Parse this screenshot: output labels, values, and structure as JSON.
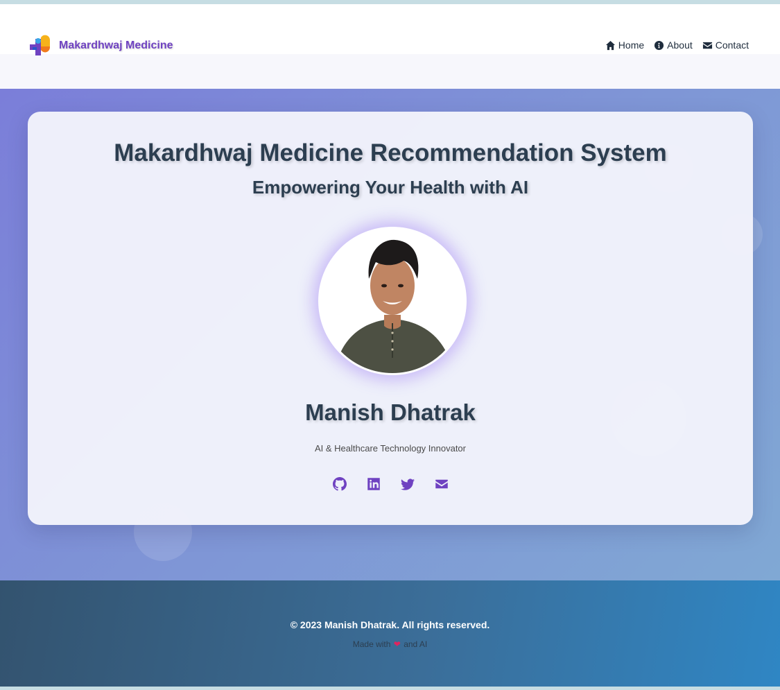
{
  "brand": {
    "name": "Makardhwaj Medicine",
    "logo_icon": "medical-cross-icon"
  },
  "nav": {
    "items": [
      {
        "label": "Home",
        "icon": "home-icon"
      },
      {
        "label": "About",
        "icon": "info-circle-icon"
      },
      {
        "label": "Contact",
        "icon": "envelope-icon"
      }
    ]
  },
  "hero": {
    "title": "Makardhwaj Medicine Recommendation System",
    "subtitle": "Empowering Your Health with AI",
    "profile": {
      "name": "Manish Dhatrak",
      "role": "AI & Healthcare Technology Innovator"
    },
    "socials": [
      {
        "icon": "github-icon"
      },
      {
        "icon": "linkedin-icon"
      },
      {
        "icon": "twitter-icon"
      },
      {
        "icon": "envelope-icon"
      }
    ]
  },
  "footer": {
    "copyright": "© 2023 Manish Dhatrak. All rights reserved.",
    "made_prefix": "Made with",
    "made_heart": "❤",
    "made_suffix": "and AI"
  },
  "colors": {
    "brand": "#6f42c1",
    "heading": "#2c3e50",
    "heart": "#e0245e",
    "footer_gradient": [
      "#33536f",
      "#2f86c4"
    ]
  }
}
